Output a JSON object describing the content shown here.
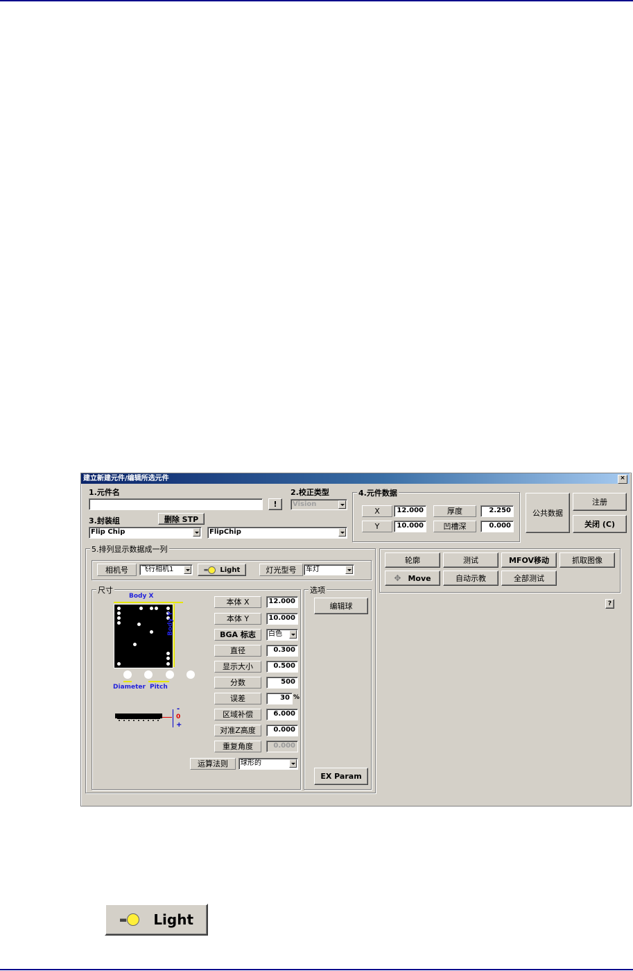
{
  "dialog": {
    "title": "建立新建元件/编辑所选元件",
    "close_glyph": "×",
    "part_name": {
      "label": "1.元件名",
      "value": "",
      "exclaim": "!"
    },
    "calibration": {
      "label": "2.校正类型",
      "value": "Vision"
    },
    "package": {
      "label": "3.封装组",
      "delete_stp": "删除 STP",
      "group_value": "Flip Chip",
      "name_value": "FlipChip"
    },
    "part_data": {
      "label": "4.元件数据",
      "x_label": "X",
      "x_value": "12.000",
      "y_label": "Y",
      "y_value": "10.000",
      "thickness_label": "厚度",
      "thickness_value": "2.250",
      "groove_label": "凹槽深",
      "groove_value": "0.000"
    },
    "common_data": "公共数据",
    "register": "注册",
    "close": "关闭 (C)",
    "section5": {
      "label": "5.排列显示数据成一列",
      "camera_label": "相机号",
      "camera_value": "飞行相机1",
      "light_button": "Light",
      "lamp_label": "灯光型号",
      "lamp_value": "车灯"
    },
    "size": {
      "label": "尺寸",
      "body_x_caption": "Body X",
      "body_y_caption": "Body Y",
      "diameter_caption": "Diameter",
      "pitch_caption": "Pitch",
      "z_minus": "-",
      "z_zero": "0",
      "z_plus": "+",
      "rows": [
        {
          "label": "本体 X",
          "value": "12.000"
        },
        {
          "label": "本体 Y",
          "value": "10.000"
        },
        {
          "label": "BGA 标志",
          "value": "白色"
        },
        {
          "label": "直径",
          "value": "0.300"
        },
        {
          "label": "显示大小",
          "value": "0.500"
        },
        {
          "label": "分数",
          "value": "500"
        },
        {
          "label": "误差",
          "value": "30",
          "unit": "%"
        },
        {
          "label": "区域补偿",
          "value": "6.000"
        },
        {
          "label": "对准Z高度",
          "value": "0.000"
        },
        {
          "label": "重复角度",
          "value": "0.000"
        }
      ],
      "algorithm_label": "运算法则",
      "algorithm_value": "球形的"
    },
    "options": {
      "label": "选项",
      "edit_ball": "编辑球",
      "ex_param": "EX Param"
    },
    "actions": {
      "row1": [
        "轮廓",
        "测试",
        "MFOV移动",
        "抓取图像"
      ],
      "move": "Move",
      "auto_teach": "自动示教",
      "test_all": "全部测试",
      "help": "?"
    }
  },
  "zoom_light_button": {
    "label": "Light"
  }
}
